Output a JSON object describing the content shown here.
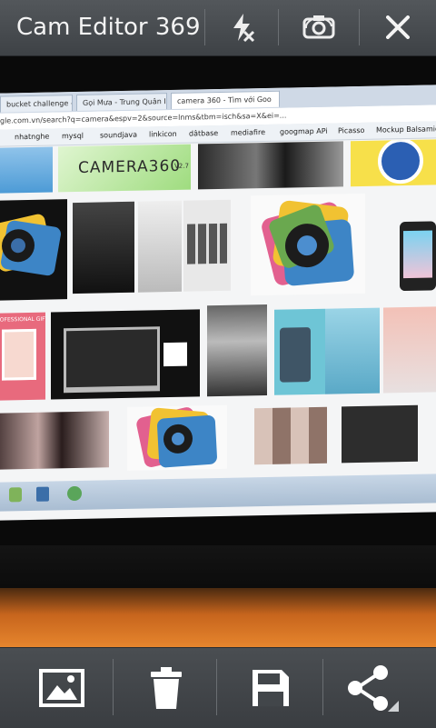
{
  "app": {
    "title": "Cam Editor 369"
  },
  "toolbar_top": {
    "icons": [
      "flash-off-icon",
      "switch-camera-icon",
      "close-icon"
    ]
  },
  "toolbar_bottom": {
    "icons": [
      "gallery-icon",
      "delete-icon",
      "save-icon",
      "share-icon"
    ]
  },
  "photo": {
    "tabs": [
      "bucket challenge - You",
      "Gọi Mưa - Trung Quân Idol",
      "camera 360 - Tìm với Goo"
    ],
    "address": "gle.com.vn/search?q=camera&espv=2&source=lnms&tbm=isch&sa=X&ei=...",
    "bookmarks": [
      "nhatnghe",
      "mysql",
      "soundjava",
      "linkicon",
      "dâtbase",
      "mediafire",
      "googmap APi",
      "Picasso",
      "Mockup Balsamiq"
    ],
    "banner_text": "CAMERA360",
    "banner_version": "V2.7",
    "poster_text": "PROFESSIONAL GIFT"
  },
  "colors": {
    "bar": "#464a4e",
    "icon": "#ffffff",
    "desk": "#d9782a"
  }
}
